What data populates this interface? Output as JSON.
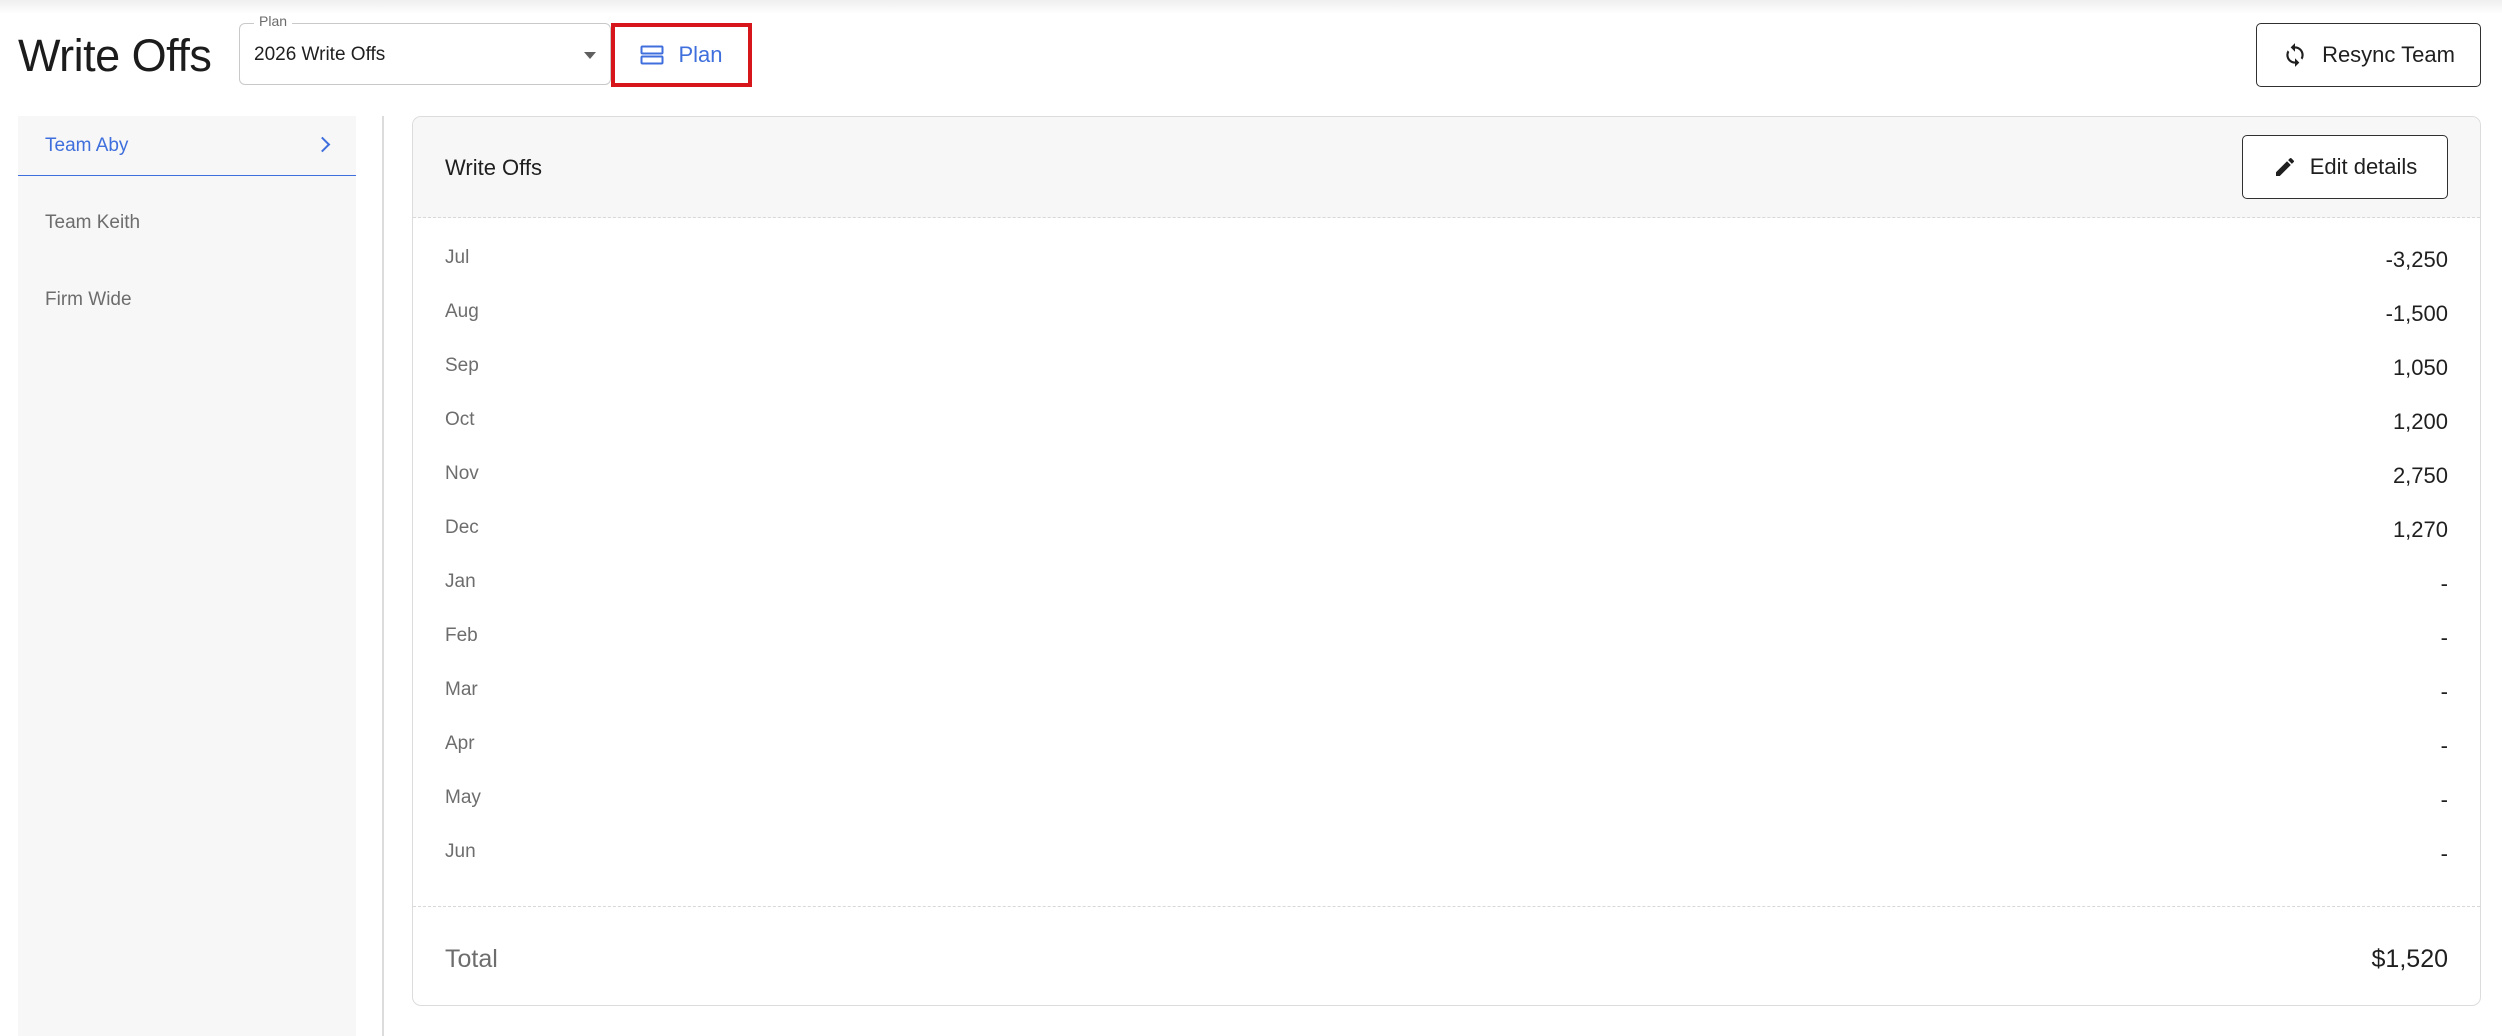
{
  "page": {
    "title": "Write Offs"
  },
  "plan_select": {
    "label": "Plan",
    "value": "2026 Write Offs"
  },
  "plan_button": {
    "label": "Plan",
    "icon": "view-agenda-icon"
  },
  "resync_button": {
    "label": "Resync Team",
    "icon": "sync-icon"
  },
  "sidebar": {
    "items": [
      {
        "label": "Team Aby",
        "active": true
      },
      {
        "label": "Team Keith",
        "active": false
      },
      {
        "label": "Firm Wide",
        "active": false
      }
    ]
  },
  "card": {
    "title": "Write Offs",
    "edit_label": "Edit details",
    "edit_icon": "pencil-icon",
    "rows": [
      {
        "month": "Jul",
        "value": "-3,250"
      },
      {
        "month": "Aug",
        "value": "-1,500"
      },
      {
        "month": "Sep",
        "value": "1,050"
      },
      {
        "month": "Oct",
        "value": "1,200"
      },
      {
        "month": "Nov",
        "value": "2,750"
      },
      {
        "month": "Dec",
        "value": "1,270"
      },
      {
        "month": "Jan",
        "value": "-"
      },
      {
        "month": "Feb",
        "value": "-"
      },
      {
        "month": "Mar",
        "value": "-"
      },
      {
        "month": "Apr",
        "value": "-"
      },
      {
        "month": "May",
        "value": "-"
      },
      {
        "month": "Jun",
        "value": "-"
      }
    ],
    "total_label": "Total",
    "total_value": "$1,520"
  },
  "colors": {
    "accent": "#3f6fdc",
    "highlight": "#d6161a",
    "sidebar_bg": "#f7f7f7"
  }
}
